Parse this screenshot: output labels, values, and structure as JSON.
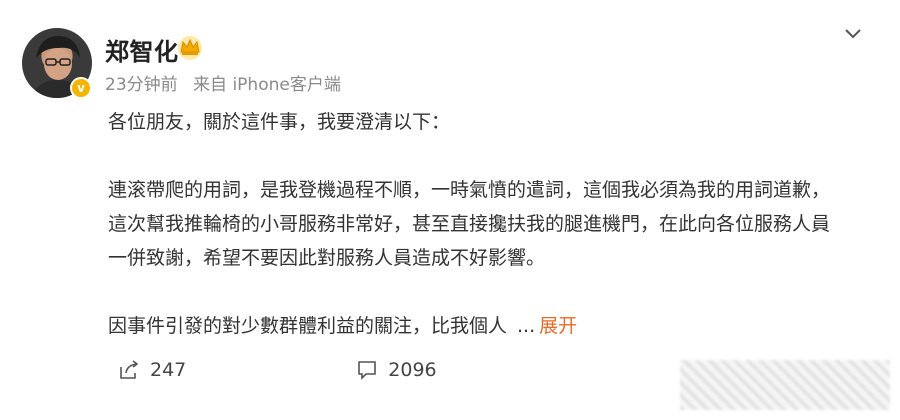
{
  "post": {
    "author": "郑智化",
    "time": "23分钟前",
    "source": "来自 iPhone客户端",
    "paragraphs": [
      "各位朋友，關於這件事，我要澄清以下：",
      "連滚帶爬的用詞，是我登機過程不順，一時氣憤的遣詞，這個我必須為我的用詞道歉，這次幫我推輪椅的小哥服務非常好，甚至直接攙扶我的腿進機門，在此向各位服務人員一併致謝，希望不要因此對服務人員造成不好影響。",
      "因事件引發的對少數群體利益的關注，比我個人"
    ],
    "ellipsis": "...",
    "expand_label": "展开"
  },
  "actions": {
    "share_count": "247",
    "comment_count": "2096"
  },
  "icons": {
    "avatar": "avatar-photo",
    "verified": "verified-badge-icon",
    "crown": "crown-icon",
    "menu": "chevron-down-icon",
    "share": "share-icon",
    "comment": "comment-icon"
  },
  "colors": {
    "accent": "#e86b26",
    "verified": "#f4b400",
    "meta": "#8a8a8a"
  }
}
